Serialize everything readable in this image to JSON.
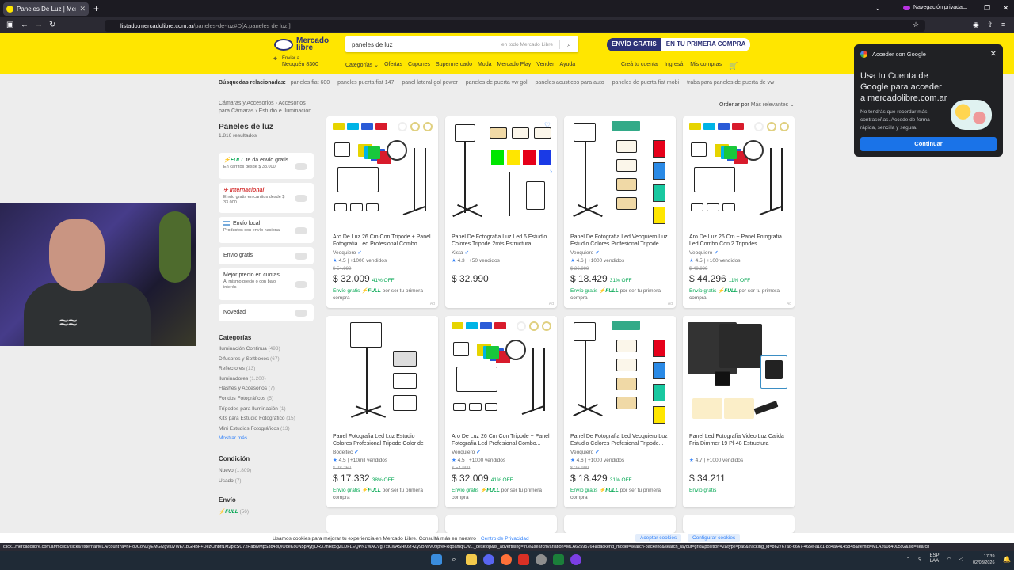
{
  "browser": {
    "tab_title": "Paneles De Luz | MercadoLibre",
    "new_tab": "+",
    "private_label": "Navegación privada",
    "url_domain": "listado.mercadolibre.com.ar",
    "url_path": "/paneles-de-luz#D[A:paneles de luz ]",
    "status_url": "click1.mercadolibre.com.ar/mclics/clicks/external/MLA/count?a=nFloJCoNXyEMG/2gvIuVWE/1bGHBF+DezCmbfNXt2picSC72HaBivMpS3b4dQ/OdeKo0N5pAyfjlDRX7hHq5gZLDFLEQPN1WACVgl7xlCwASHK6z+Zy9BNvvU9pre+RqoamqjC/v..._desktop&is_advertising=true&searchVariation=MLA62595764&backend_model=search-backend&search_layout=grid&position=2&type=pad&tracking_id=862767ad-6667-465e-a1c1-8b4a6414584b&itemid=MLA2608400592&sid=search"
  },
  "header": {
    "logo_line1": "Mercado",
    "logo_line2": "libre",
    "search_value": "paneles de luz",
    "search_scope": "en todo Mercado Libre",
    "promo_a": "ENVÍO GRATIS",
    "promo_b": "EN TU PRIMERA COMPRA",
    "location_line1": "Enviar a",
    "location_line2": "Neuquén 8300",
    "nav": [
      "Categorías ⌄",
      "Ofertas",
      "Cupones",
      "Supermercado",
      "Moda",
      "Mercado Play",
      "Vender",
      "Ayuda"
    ],
    "user_nav": [
      "Creá tu cuenta",
      "Ingresá",
      "Mis compras"
    ]
  },
  "google_popup": {
    "header": "Acceder con Google",
    "title": "Usa tu Cuenta de Google para acceder a mercadolibre.com.ar",
    "desc": "No tendrás que recordar más contraseñas. Accede de forma rápida, sencilla y segura.",
    "button": "Continuar"
  },
  "related": {
    "label": "Búsquedas relacionadas:",
    "items": [
      "paneles fiat 600",
      "paneles puerta fiat 147",
      "panel lateral gol power",
      "paneles de puerta vw gol",
      "paneles acusticos para auto",
      "paneles de puerta fiat mobi",
      "traba para paneles de puerta de vw"
    ]
  },
  "breadcrumb": "Cámaras y Accesorios  ›  Accesorios para Cámaras  ›  Estudio e Iluminación",
  "sort": {
    "label": "Ordenar por",
    "value": "Más relevantes ⌄"
  },
  "page_title": "Paneles de luz",
  "results": "1.816 resultados",
  "filters": {
    "full_a": "⚡FULL",
    "full_b": " te da envío gratis",
    "full_sub": "En carritos desde $ 33.000",
    "intl": "✈ Internacional",
    "intl_sub": "Envío gratis en carritos desde $ 33.000",
    "local": "Envío local",
    "local_sub": "Productos con envío nacional",
    "free": "Envío gratis",
    "best": "Mejor precio en cuotas",
    "best_sub": "Al mismo precio o con bajo interés",
    "new": "Novedad"
  },
  "categories": {
    "title": "Categorías",
    "items": [
      {
        "name": "Iluminación Continua",
        "count": "(493)"
      },
      {
        "name": "Difusores y Softboxes",
        "count": "(67)"
      },
      {
        "name": "Reflectores",
        "count": "(13)"
      },
      {
        "name": "Iluminadores",
        "count": "(1.200)"
      },
      {
        "name": "Flashes y Accesorios",
        "count": "(7)"
      },
      {
        "name": "Fondos Fotográficos",
        "count": "(5)"
      },
      {
        "name": "Trípodes para Iluminación",
        "count": "(1)"
      },
      {
        "name": "Kits para Estudio Fotográfico",
        "count": "(15)"
      },
      {
        "name": "Mini Estudios Fotográficos",
        "count": "(13)"
      }
    ],
    "more": "Mostrar más"
  },
  "condition": {
    "title": "Condición",
    "items": [
      {
        "name": "Nuevo",
        "count": "(1.809)"
      },
      {
        "name": "Usado",
        "count": "(7)"
      }
    ]
  },
  "shipping": {
    "title": "Envío",
    "full": "⚡FULL",
    "count": "(56)"
  },
  "products": [
    {
      "title": "Aro De Luz 26 Cm Con Tripode + Panel Fotografia Led Profesional Combo...",
      "seller": "Veoquiero",
      "rating": "4.5",
      "sold": "| +1000 vendidos",
      "old": "$ 54.999",
      "price": "$ 32.009",
      "off": "41% OFF",
      "ship_a": "Envío gratis",
      "ship_b": "⚡FULL",
      "ship_c": " por ser tu primera compra",
      "ad": "Ad"
    },
    {
      "title": "Panel De Fotografia Luz Led 6 Estudio Colores Tripode 2mts Estructura Negro...",
      "seller": "Kista",
      "rating": "4.3",
      "sold": "| +50 vendidos",
      "old": "",
      "price": "$ 32.990",
      "off": "",
      "ship_a": "",
      "ship_b": "",
      "ship_c": "",
      "ad": "Ad"
    },
    {
      "title": "Panel De Fotografia Led Veoquiero Luz Estudio Colores Profesional Tripode...",
      "seller": "Veoquiero",
      "rating": "4.6",
      "sold": "| +1000 vendidos",
      "old": "$ 26.999",
      "price": "$ 18.429",
      "off": "31% OFF",
      "ship_a": "Envío gratis",
      "ship_b": "⚡FULL",
      "ship_c": " por ser tu primera compra",
      "ad": "Ad"
    },
    {
      "title": "Aro De Luz 26 Cm + Panel Fotografia Led Combo Con 2 Tripodes Profesional...",
      "seller": "Veoquiero",
      "rating": "4.5",
      "sold": "| +100 vendidos",
      "old": "$ 49.999",
      "price": "$ 44.296",
      "off": "11% OFF",
      "ship_a": "Envío gratis",
      "ship_b": "⚡FULL",
      "ship_c": " por ser tu primera compra",
      "ad": "Ad"
    },
    {
      "title": "Panel Fotografia Led Luz Estudio Colores Profesional Tripode Color de la...",
      "seller": "Bodeltec",
      "rating": "4.5",
      "sold": "| +10mil vendidos",
      "old": "$ 28.262",
      "price": "$ 17.332",
      "off": "38% OFF",
      "ship_a": "Envío gratis",
      "ship_b": "⚡FULL",
      "ship_c": " por ser tu primera compra",
      "ad": ""
    },
    {
      "title": "Aro De Luz 26 Cm Con Tripode + Panel Fotografia Led Profesional Combo...",
      "seller": "Veoquiero",
      "rating": "4.5",
      "sold": "| +1000 vendidos",
      "old": "$ 54.999",
      "price": "$ 32.009",
      "off": "41% OFF",
      "ship_a": "Envío gratis",
      "ship_b": "⚡FULL",
      "ship_c": " por ser tu primera compra",
      "ad": ""
    },
    {
      "title": "Panel De Fotografia Led Veoquiero Luz Estudio Colores Profesional Tripode...",
      "seller": "Veoquiero",
      "rating": "4.6",
      "sold": "| +1000 vendidos",
      "old": "$ 26.999",
      "price": "$ 18.429",
      "off": "31% OFF",
      "ship_a": "Envío gratis",
      "ship_b": "⚡FULL",
      "ship_c": " por ser tu primera compra",
      "ad": ""
    },
    {
      "title": "Panel Led Fotografia Video Luz Calida Fria Dimmer 19 Pl-48 Estructura Negro...",
      "seller": "",
      "rating": "4.7",
      "sold": "| +1000 vendidos",
      "old": "",
      "price": "$ 34.211",
      "off": "",
      "ship_a": "Envío gratis",
      "ship_b": "",
      "ship_c": "",
      "ad": ""
    }
  ],
  "cookie": {
    "text": "Usamos cookies para mejorar tu experiencia en Mercado Libre. Consultá más en nuestro",
    "link": "Centro de Privacidad",
    "accept": "Aceptar cookies",
    "config": "Configurar cookies"
  },
  "tray": {
    "lang1": "ESP",
    "lang2": "LAA",
    "time": "17:39",
    "date": "02/03/2026"
  },
  "colors": {
    "brand_yellow": "#ffe600",
    "brand_navy": "#2d3277",
    "accent_blue": "#3483fa",
    "green": "#00a650"
  }
}
